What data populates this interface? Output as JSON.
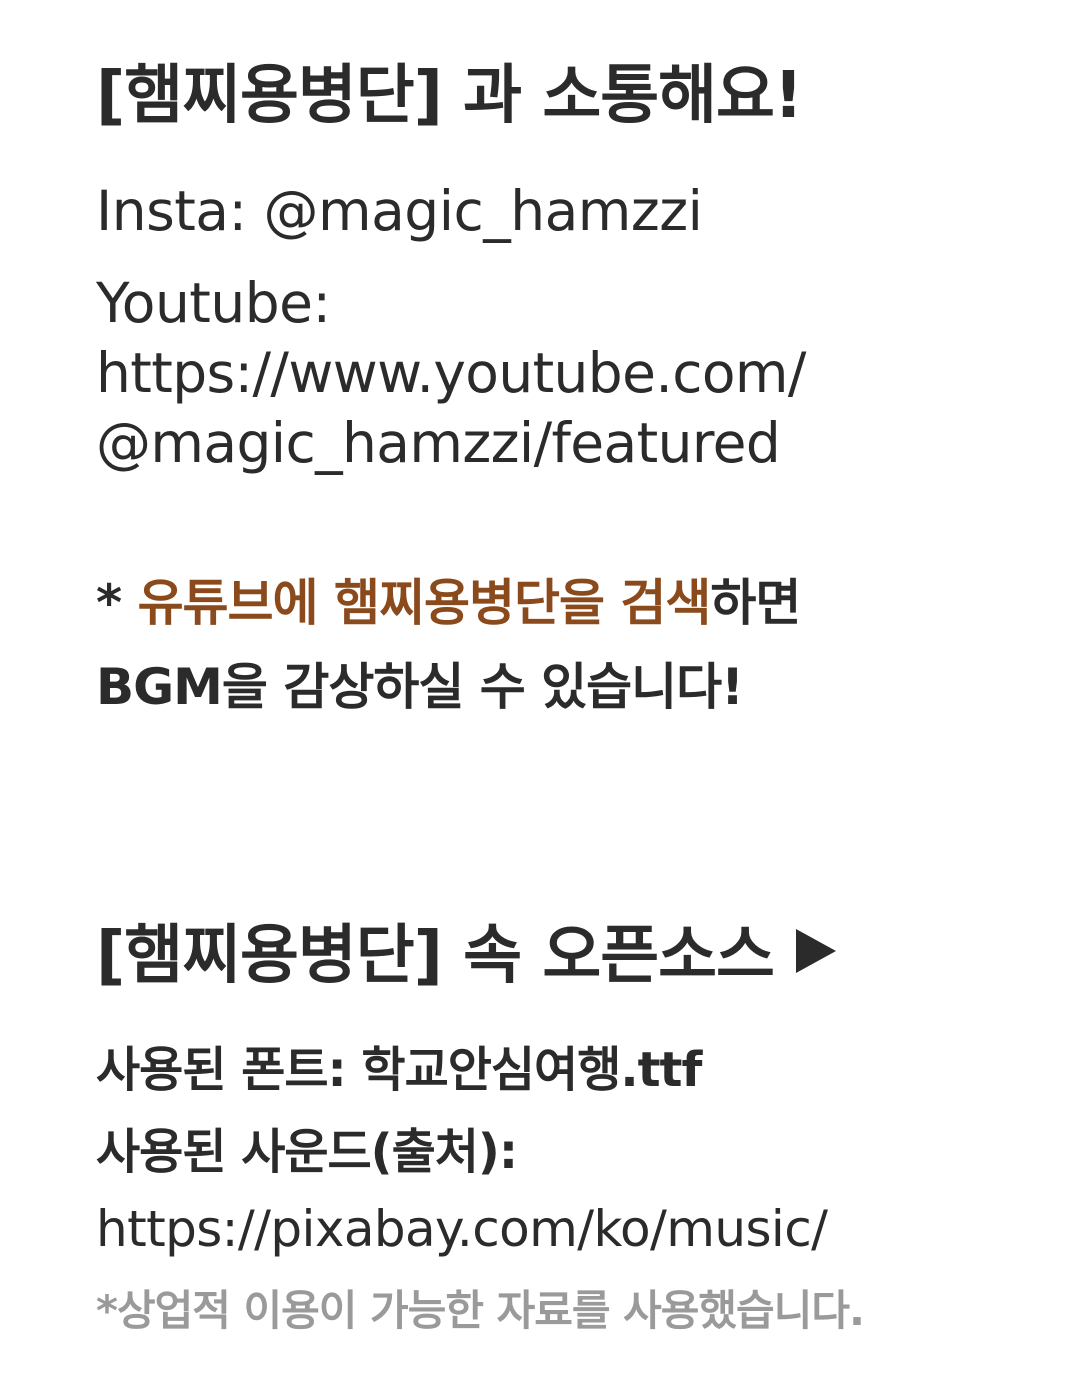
{
  "contact": {
    "heading": "[햄찌용병단] 과 소통해요!",
    "insta": "Insta: @magic_hamzzi",
    "youtube_label": "Youtube:",
    "youtube_url_line1": "https://www.youtube.com/",
    "youtube_url_line2": "@magic_hamzzi/featured"
  },
  "bgm_note": {
    "prefix": "* ",
    "highlight": "유튜브에 햄찌용병단을 검색",
    "suffix": "하면",
    "line2": "BGM을 감상하실 수 있습니다!",
    "accent_color": "#8b4a1c"
  },
  "open_source": {
    "heading": "[햄찌용병단] 속 오픈소스",
    "arrow_icon": "play-triangle-icon",
    "font_used": "사용된 폰트: 학교안심여행.ttf",
    "sound_used": "사용된 사운드(출처):",
    "sound_url": "https://pixabay.com/ko/music/",
    "disclaimer": "*상업적 이용이 가능한 자료를 사용했습니다."
  }
}
